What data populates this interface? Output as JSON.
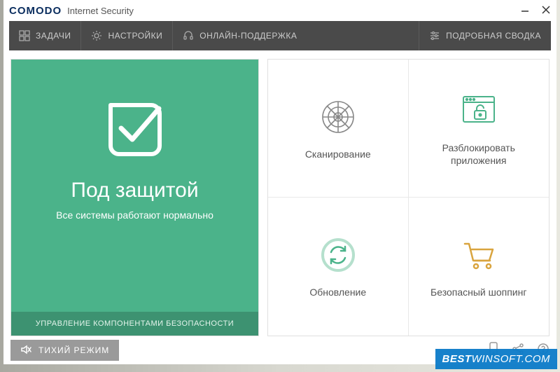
{
  "titlebar": {
    "brand": "COMODO",
    "subtitle": "Internet Security"
  },
  "toolbar": {
    "tasks": "ЗАДАЧИ",
    "settings": "НАСТРОЙКИ",
    "support": "ОНЛАЙН-ПОДДЕРЖКА",
    "detailed_summary": "ПОДРОБНАЯ СВОДКА"
  },
  "status": {
    "title": "Под защитой",
    "subtitle": "Все системы работают нормально",
    "components_label": "УПРАВЛЕНИЕ КОМПОНЕНТАМИ БЕЗОПАСНОСТИ"
  },
  "tiles": {
    "scan": "Сканирование",
    "unblock_apps": "Разблокировать приложения",
    "update": "Обновление",
    "secure_shopping": "Безопасный шоппинг"
  },
  "bottombar": {
    "silent_mode": "ТИХИЙ РЕЖИМ"
  },
  "watermark": {
    "text_bold": "BEST",
    "text_thin": "WINSOFT.COM"
  },
  "colors": {
    "accent_green": "#4bb38a",
    "orange": "#d9a43e",
    "toolbar_bg": "#4a4a4a"
  }
}
